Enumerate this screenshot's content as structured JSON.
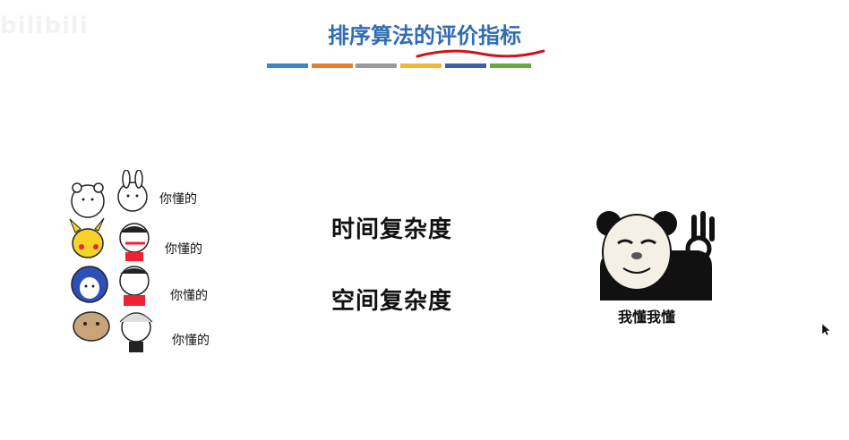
{
  "watermark": "bilibili",
  "slide": {
    "title": "排序算法的评价指标",
    "metrics": [
      "时间复杂度",
      "空间复杂度"
    ]
  },
  "color_bar": [
    "#3b86c6",
    "#e57f2e",
    "#9a9a9a",
    "#f2b72f",
    "#3c5fa8",
    "#6aaa3c"
  ],
  "accent_underline_color": "#c8171e",
  "meme_left": {
    "labels": [
      "你懂的",
      "你懂的",
      "你懂的",
      "你懂的"
    ]
  },
  "meme_right": {
    "caption": "我懂我懂"
  },
  "icons": {
    "cursor": "mouse-pointer-icon"
  }
}
